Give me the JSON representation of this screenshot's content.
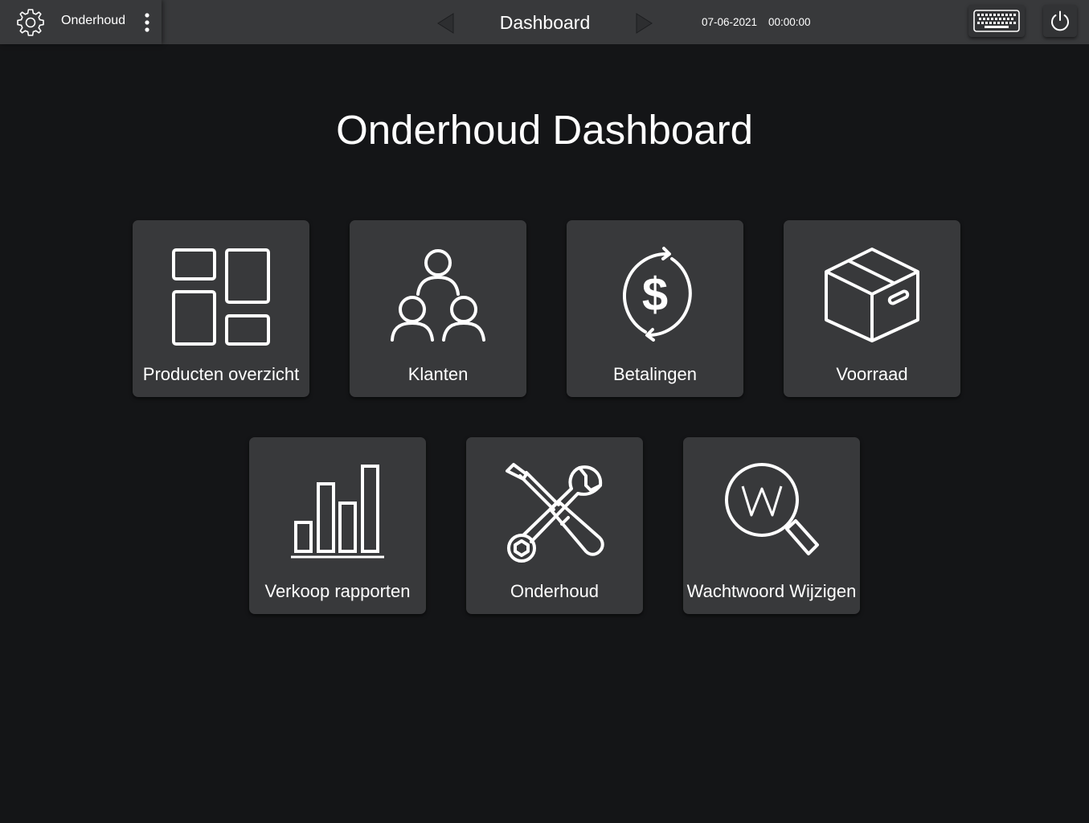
{
  "topbar": {
    "menu_label": "Onderhoud",
    "title": "Dashboard",
    "date": "07-06-2021",
    "time": "00:00:00"
  },
  "icons": {
    "settings": "gear-icon",
    "more": "kebab-menu-icon",
    "prev": "chevron-left-icon",
    "next": "chevron-right-icon",
    "keyboard": "keyboard-icon",
    "power": "power-icon"
  },
  "page": {
    "title": "Onderhoud Dashboard"
  },
  "tiles": [
    {
      "label": "Producten overzicht",
      "icon": "layout-grid-icon"
    },
    {
      "label": "Klanten",
      "icon": "users-icon"
    },
    {
      "label": "Betalingen",
      "icon": "dollar-refresh-icon"
    },
    {
      "label": "Voorraad",
      "icon": "box-icon"
    },
    {
      "label": "Verkoop rapporten",
      "icon": "bar-chart-icon"
    },
    {
      "label": "Onderhoud",
      "icon": "tools-icon"
    },
    {
      "label": "Wachtwoord Wijzigen",
      "icon": "password-search-icon"
    }
  ],
  "colors": {
    "background": "#141517",
    "topbar": "#38393b",
    "tile": "#38393b",
    "text": "#ffffff"
  }
}
